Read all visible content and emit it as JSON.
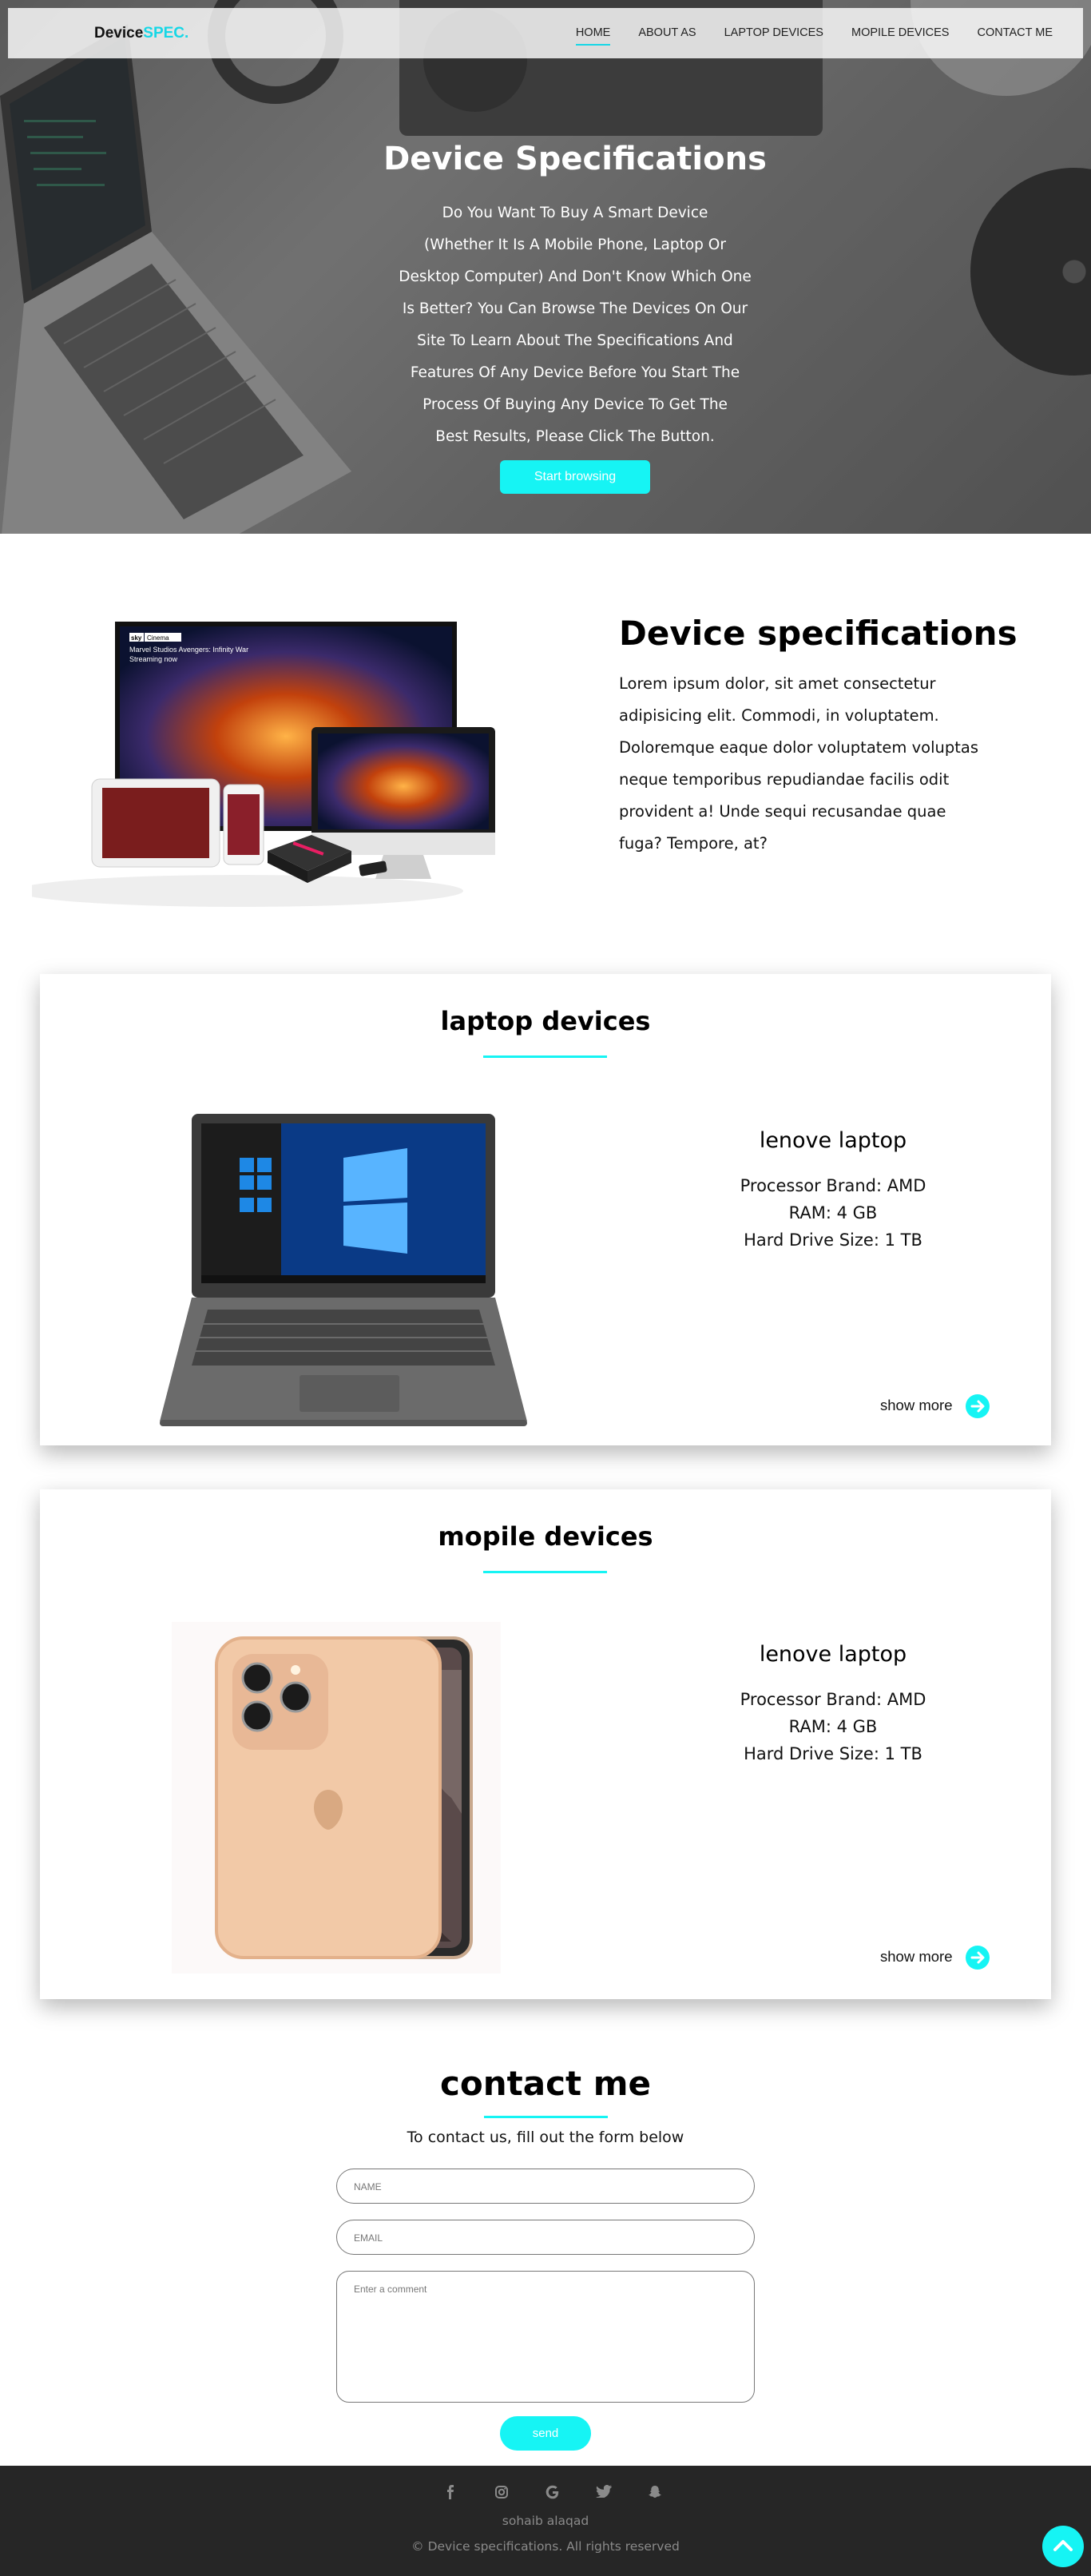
{
  "nav": {
    "brand_main": "Device",
    "brand_accent": "SPEC.",
    "items": [
      "HOME",
      "ABOUT AS",
      "LAPTOP DEVICES",
      "MOPILE DEVICES",
      "CONTACT ME"
    ],
    "active": "HOME"
  },
  "hero": {
    "title": "Device Specifications",
    "text_lines": [
      "Do You Want To Buy A Smart Device",
      "(Whether It Is A Mobile Phone, Laptop Or",
      "Desktop Computer) And Don't Know Which One",
      "Is Better? You Can Browse The Devices On Our",
      "Site To Learn About The Specifications And",
      "Features Of Any Device Before You Start The",
      "Process Of Buying Any Device   To Get The",
      "Best Results, Please Click The Button."
    ],
    "button": "Start browsing"
  },
  "about": {
    "title": "Device specifications",
    "text_lines": [
      "Lorem ipsum dolor, sit amet consectetur",
      "adipisicing elit. Commodi, in voluptatem.",
      "Doloremque eaque dolor voluptatem voluptas",
      "neque temporibus repudiandae facilis odit",
      "provident a! Unde sequi recusandae quae",
      "fuga? Tempore, at?"
    ],
    "image_caption_brand": "sky",
    "image_caption_tag": "Cinema",
    "image_caption_line1": "Marvel Studios Avengers: Infinity War",
    "image_caption_line2": "Streaming now"
  },
  "laptop": {
    "section_title": "laptop devices",
    "device_name": "lenove laptop",
    "specs": [
      "Processor Brand: AMD",
      "RAM: 4 GB",
      "Hard Drive Size: 1 TB"
    ],
    "show_more": "show more"
  },
  "mobile": {
    "section_title": "mopile devices",
    "device_name": "lenove laptop",
    "specs": [
      "Processor Brand: AMD",
      "RAM: 4 GB",
      "Hard Drive Size: 1 TB"
    ],
    "show_more": "show more"
  },
  "contact": {
    "title": "contact me",
    "subtitle": "To contact us, fill out the form below",
    "name_placeholder": "NAME",
    "email_placeholder": "EMAIL",
    "comment_placeholder": "Enter a comment",
    "send": "send"
  },
  "footer": {
    "social_icons": [
      "facebook-icon",
      "instagram-icon",
      "google-icon",
      "twitter-icon",
      "snapchat-icon"
    ],
    "name": "sohaib alaqad",
    "copyright": "© Device specifications. All rights reserved"
  },
  "colors": {
    "accent": "#16f4f4",
    "brand_accent": "#16d7e6",
    "footer_bg": "#262626"
  }
}
